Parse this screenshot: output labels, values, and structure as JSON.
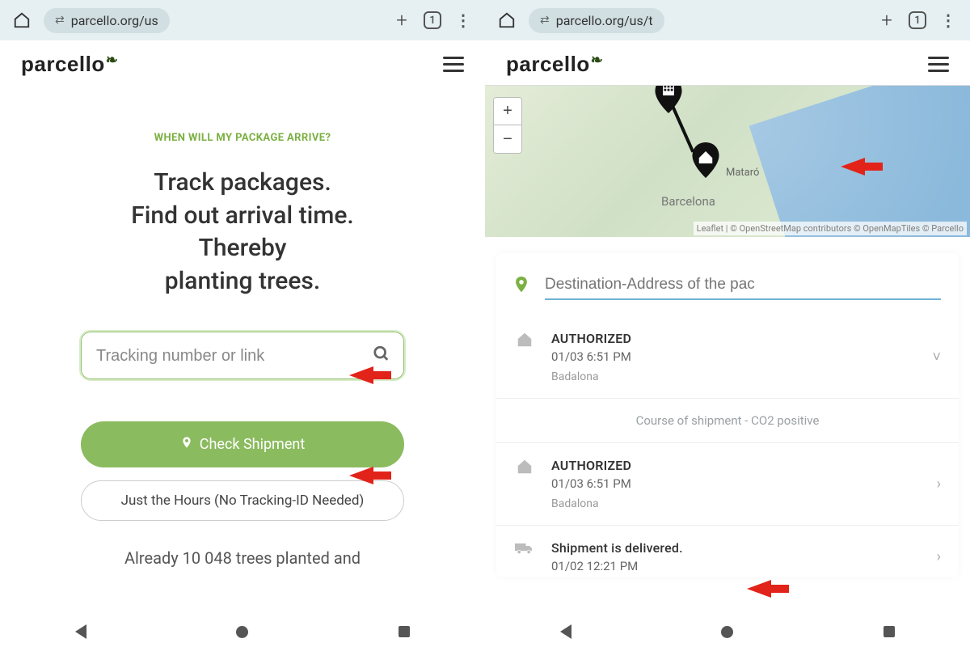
{
  "left": {
    "chrome": {
      "url": "parcello.org/us",
      "tab_count": "1"
    },
    "logo": "parcello",
    "eyebrow": "WHEN WILL MY PACKAGE ARRIVE?",
    "hero_l1": "Track packages.",
    "hero_l2": "Find out arrival time.",
    "hero_l3": "Thereby",
    "hero_l4": "planting trees.",
    "search_placeholder": "Tracking number or link",
    "primary_btn": "Check Shipment",
    "secondary_btn": "Just the Hours (No Tracking-ID Needed)",
    "sub_note": "Already 10 048 trees planted and"
  },
  "right": {
    "chrome": {
      "url": "parcello.org/us/t",
      "tab_count": "1"
    },
    "logo": "parcello",
    "map": {
      "city_label_1": "Mataró",
      "city_label_2": "Barcelona",
      "attribution": "Leaflet | © OpenStreetMap contributors © OpenMapTiles © Parcello",
      "zoom_in": "+",
      "zoom_out": "−"
    },
    "address_placeholder": "Destination-Address of the pac",
    "events": [
      {
        "icon": "home",
        "title": "AUTHORIZED",
        "time": "01/03 6:51 PM",
        "loc": "Badalona",
        "chev": "˅"
      }
    ],
    "group_label": "Course of shipment - CO2 positive",
    "events2": [
      {
        "icon": "home",
        "title": "AUTHORIZED",
        "time": "01/03 6:51 PM",
        "loc": "Badalona",
        "chev": "›"
      },
      {
        "icon": "truck",
        "title": "Shipment is delivered.",
        "time": "01/02 12:21 PM",
        "loc": "",
        "chev": "›"
      }
    ]
  }
}
